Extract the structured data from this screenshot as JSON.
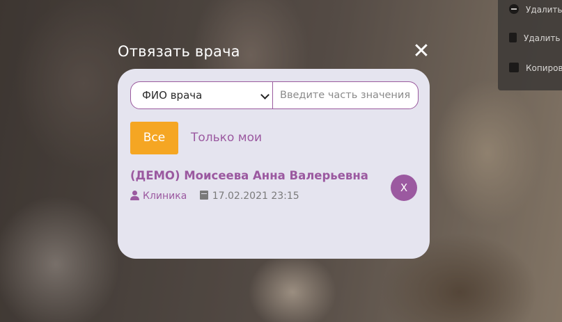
{
  "modal": {
    "title": "Отвязать врача",
    "close_icon": "close-icon"
  },
  "filter": {
    "field_selected": "ФИО врача",
    "search_placeholder": "Введите часть значения"
  },
  "toggles": {
    "all_label": "Все",
    "mine_label": "Только мои"
  },
  "doctor": {
    "name": "(ДЕМО) Моисеева Анна Валерьевна",
    "clinic": "Клиника",
    "datetime": "17.02.2021 23:15",
    "remove_label": "X"
  },
  "context_menu": {
    "items": [
      "Удалить",
      "Удалить",
      "Копировать"
    ]
  },
  "colors": {
    "accent": "#9b59a0",
    "orange": "#f5a623",
    "modal_bg": "#e5e4ef"
  }
}
